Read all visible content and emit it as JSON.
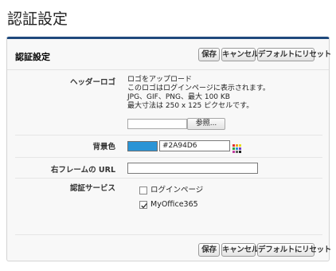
{
  "page": {
    "title": "認証設定"
  },
  "panel": {
    "title": "認証設定",
    "buttons": {
      "save": "保存",
      "cancel": "キャンセル",
      "reset": "デフォルトにリセット"
    }
  },
  "header_logo": {
    "label": "ヘッダーロゴ",
    "lines": [
      "ロゴをアップロード",
      "このロゴはログインページに表示されます。",
      "JPG、GIF、PNG、最大 100 KB",
      "最大寸法は 250 x 125 ピクセルです。"
    ],
    "browse_label": "参照..."
  },
  "background": {
    "label": "背景色",
    "value": "#2A94D6",
    "swatch_color": "#2a94d6"
  },
  "right_frame": {
    "label": "右フレームの URL",
    "value": ""
  },
  "auth_services": {
    "label": "認証サービス",
    "items": [
      {
        "label": "ログインページ",
        "checked": false
      },
      {
        "label": "MyOffice365",
        "checked": true
      }
    ]
  }
}
